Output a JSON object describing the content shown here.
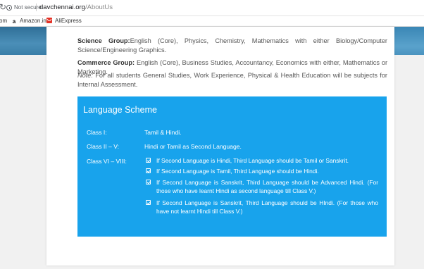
{
  "browser": {
    "security_label": "Not secure",
    "url_host": "davchennai.org",
    "url_path": "/AboutUs"
  },
  "bookmarks": [
    {
      "label": "om",
      "icon": "bookmark-fragment"
    },
    {
      "label": "Amazon.in",
      "icon": "amazon-icon"
    },
    {
      "label": "AliExpress",
      "icon": "aliexpress-icon"
    }
  ],
  "groups": {
    "science": {
      "label": "Science Group:",
      "text": "English (Core), Physics, Chemistry, Mathematics with either Biology/Computer Science/Engineering Graphics."
    },
    "commerce": {
      "label": "Commerce Group:",
      "text": " English (Core), Business Studies, Accountancy, Economics with either, Mathematics or Marketing."
    },
    "note": {
      "label": "Note:",
      "text": " For all students General Studies, Work Experience, Physical & Health Education will be subjects for Internal Assessment."
    }
  },
  "language_scheme": {
    "title": "Language Scheme",
    "rows": [
      {
        "label": "Class I:",
        "value": "Tamil & Hindi."
      },
      {
        "label": "Class II – V:",
        "value": "Hindi or Tamil as Second Language."
      },
      {
        "label": "Class VI – VIII:",
        "value": ""
      }
    ],
    "class6_8_items": [
      "If Second Language is Hindi, Third Language should be Tamil or Sanskrit.",
      "If Second Language is Tamil, Third Language should be Hindi.",
      "If Second Language is Sanskrit, Third Language should be Advanced Hindi. (For those who have learnt Hindi as second language till Class V.)",
      "If Second Language is Sanskrit, Third Language should be HIndi. (For those who have not learnt Hindi till Class V.)"
    ],
    "background": "#18a3ec"
  }
}
